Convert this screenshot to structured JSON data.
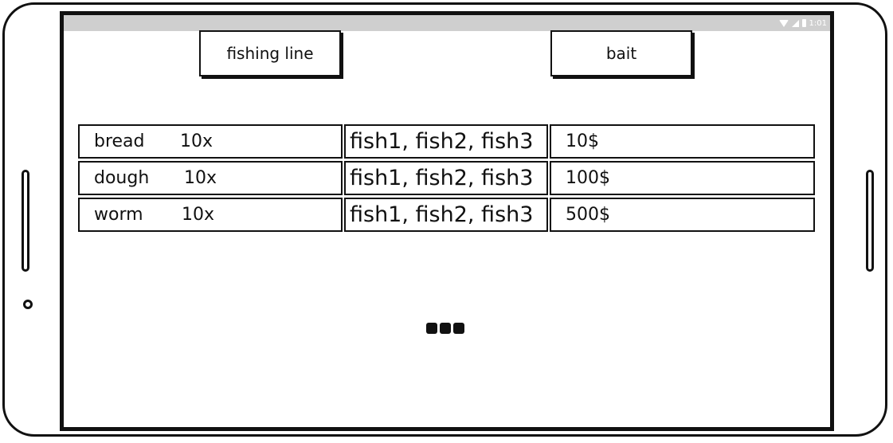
{
  "status_bar": {
    "time": "1:01",
    "icons": [
      "wifi-icon",
      "signal-icon",
      "battery-icon"
    ]
  },
  "tabs": [
    {
      "label": "fishing line"
    },
    {
      "label": "bait"
    }
  ],
  "bait_list": {
    "rows": [
      {
        "name": "bread",
        "quantity": "10x",
        "fish": "fish1, fish2, fish3",
        "price": "10$"
      },
      {
        "name": "dough",
        "quantity": "10x",
        "fish": "fish1, fish2, fish3",
        "price": "100$"
      },
      {
        "name": "worm",
        "quantity": "10x",
        "fish": "fish1, fish2, fish3",
        "price": "500$"
      }
    ]
  },
  "more_indicator": {
    "icon": "more-dots-icon"
  },
  "colors": {
    "status_bar": "#cfcfcf",
    "ink": "#111111",
    "background": "#ffffff"
  }
}
